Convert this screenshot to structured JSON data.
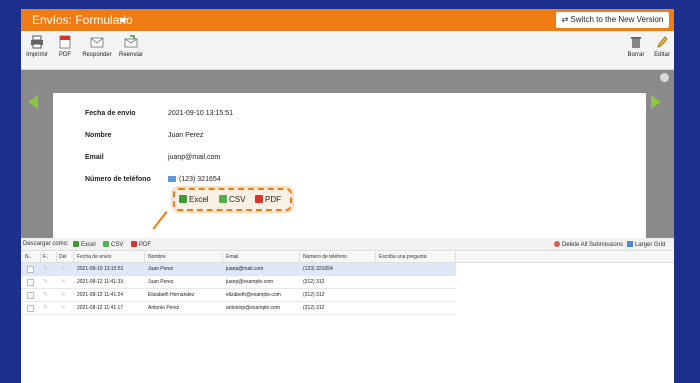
{
  "header": {
    "title": "Envíos: Formulario",
    "switch_icon": "⇄",
    "switch_label": "Switch to the New Version"
  },
  "toolbar": {
    "print": "Imprimir",
    "pdf": "PDF",
    "reply": "Responder",
    "forward": "Reenviar",
    "delete": "Borrar",
    "edit": "Editar"
  },
  "submission": {
    "fields": [
      {
        "label": "Fecha de envío",
        "value": "2021-09-10 13:15:51"
      },
      {
        "label": "Nombre",
        "value": "Juan Perez"
      },
      {
        "label": "Email",
        "value": "juanp@mail.com"
      },
      {
        "label": "Número de teléfono",
        "value": "(123) 321654"
      }
    ]
  },
  "callout": {
    "excel": "Excel",
    "csv": "CSV",
    "pdf": "PDF"
  },
  "download_bar": {
    "label": "Descargar como:",
    "excel": "Excel",
    "csv": "CSV",
    "pdf": "PDF",
    "delete_all": "Delete All Submissions",
    "larger_grid": "Larger Grid"
  },
  "table": {
    "columns": [
      "N..",
      "F..",
      "Del",
      "Fecha de envío",
      "Nombre",
      "Email",
      "Número de teléfono",
      "Escriba una pregunta"
    ],
    "rows": [
      {
        "date": "2021-09-10 13:15:51",
        "name": "Juan Perez",
        "email": "juanp@mail.com",
        "phone": "(123) 321654"
      },
      {
        "date": "2021-08-12 11:41:33",
        "name": "Juan Perez",
        "email": "juanp@example.com",
        "phone": "(312) 312"
      },
      {
        "date": "2021-08-12 11:41:24",
        "name": "Elizabeth Hernandez",
        "email": "elizabeth@example.com",
        "phone": "(312) 312"
      },
      {
        "date": "2021-08-12 11:41:17",
        "name": "Antonio Perez",
        "email": "antoniop@example.com",
        "phone": "(312) 312"
      }
    ]
  },
  "colors": {
    "brand_orange": "#f07d14",
    "background": "#1d2f8c",
    "nav_arrow": "#8cc63f"
  }
}
